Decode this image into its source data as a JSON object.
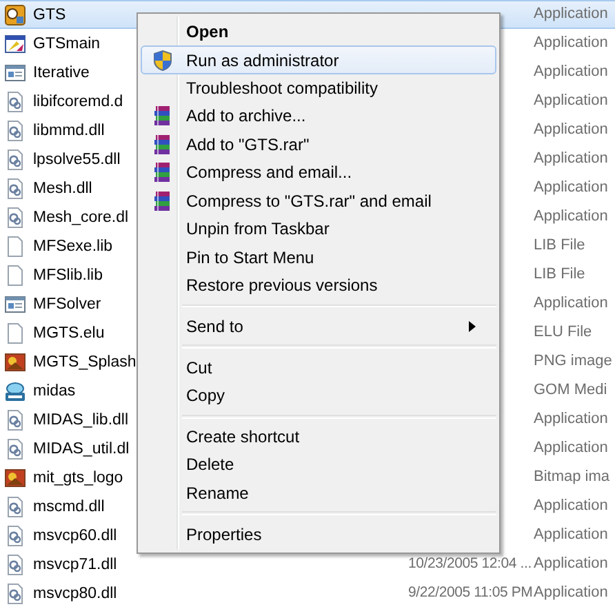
{
  "files": [
    {
      "name": "GTS",
      "kind": "app",
      "type": "Application",
      "selected": true
    },
    {
      "name": "GTSmain",
      "kind": "tool",
      "type": "Application",
      "selected": false
    },
    {
      "name": "Iterative",
      "kind": "window",
      "type": "Application",
      "selected": false
    },
    {
      "name": "libifcoremd.d",
      "kind": "dll",
      "type": "Application",
      "selected": false
    },
    {
      "name": "libmmd.dll",
      "kind": "dll",
      "type": "Application",
      "selected": false
    },
    {
      "name": "lpsolve55.dll",
      "kind": "dll",
      "type": "Application",
      "selected": false
    },
    {
      "name": "Mesh.dll",
      "kind": "dll",
      "type": "Application",
      "selected": false
    },
    {
      "name": "Mesh_core.dl",
      "kind": "dll",
      "type": "Application",
      "selected": false
    },
    {
      "name": "MFSexe.lib",
      "kind": "blank",
      "type": "LIB File",
      "selected": false
    },
    {
      "name": "MFSlib.lib",
      "kind": "blank",
      "type": "LIB File",
      "selected": false
    },
    {
      "name": "MFSolver",
      "kind": "window",
      "type": "Application",
      "selected": false
    },
    {
      "name": "MGTS.elu",
      "kind": "blank",
      "type": "ELU File",
      "selected": false
    },
    {
      "name": "MGTS_Splash",
      "kind": "image",
      "type": "PNG image",
      "selected": false
    },
    {
      "name": "midas",
      "kind": "media",
      "type": "GOM Medi",
      "selected": false
    },
    {
      "name": "MIDAS_lib.dll",
      "kind": "dll",
      "type": "Application",
      "selected": false
    },
    {
      "name": "MIDAS_util.dl",
      "kind": "dll",
      "type": "Application",
      "selected": false
    },
    {
      "name": "mit_gts_logo",
      "kind": "image",
      "type": "Bitmap ima",
      "selected": false
    },
    {
      "name": "mscmd.dll",
      "kind": "dll",
      "type": "Application",
      "selected": false
    },
    {
      "name": "msvcp60.dll",
      "kind": "dll",
      "type": "Application",
      "selected": false
    },
    {
      "name": "msvcp71.dll",
      "kind": "dll",
      "date": "10/23/2005 12:04 ...",
      "type": "Application",
      "selected": false
    },
    {
      "name": "msvcp80.dll",
      "kind": "dll",
      "date": "9/22/2005 11:05 PM",
      "type": "Application",
      "selected": false
    }
  ],
  "context_menu": {
    "items": [
      {
        "kind": "item",
        "label": "Open",
        "default": true,
        "selected": false
      },
      {
        "kind": "shield_item",
        "label": "Run as administrator",
        "default": false,
        "selected": true
      },
      {
        "kind": "item",
        "label": "Troubleshoot compatibility",
        "default": false,
        "selected": false
      },
      {
        "kind": "archive_item",
        "label": "Add to archive...",
        "default": false,
        "selected": false
      },
      {
        "kind": "archive_item",
        "label": "Add to \"GTS.rar\"",
        "default": false,
        "selected": false
      },
      {
        "kind": "archive_item",
        "label": "Compress and email...",
        "default": false,
        "selected": false
      },
      {
        "kind": "archive_item",
        "label": "Compress to \"GTS.rar\" and email",
        "default": false,
        "selected": false
      },
      {
        "kind": "item",
        "label": "Unpin from Taskbar",
        "default": false,
        "selected": false
      },
      {
        "kind": "item",
        "label": "Pin to Start Menu",
        "default": false,
        "selected": false
      },
      {
        "kind": "item",
        "label": "Restore previous versions",
        "default": false,
        "selected": false
      },
      {
        "kind": "separator"
      },
      {
        "kind": "submenu",
        "label": "Send to",
        "default": false,
        "selected": false
      },
      {
        "kind": "separator"
      },
      {
        "kind": "item",
        "label": "Cut",
        "default": false,
        "selected": false
      },
      {
        "kind": "item",
        "label": "Copy",
        "default": false,
        "selected": false
      },
      {
        "kind": "separator"
      },
      {
        "kind": "item",
        "label": "Create shortcut",
        "default": false,
        "selected": false
      },
      {
        "kind": "item",
        "label": "Delete",
        "default": false,
        "selected": false
      },
      {
        "kind": "item",
        "label": "Rename",
        "default": false,
        "selected": false
      },
      {
        "kind": "separator"
      },
      {
        "kind": "item",
        "label": "Properties",
        "default": false,
        "selected": false
      }
    ]
  }
}
